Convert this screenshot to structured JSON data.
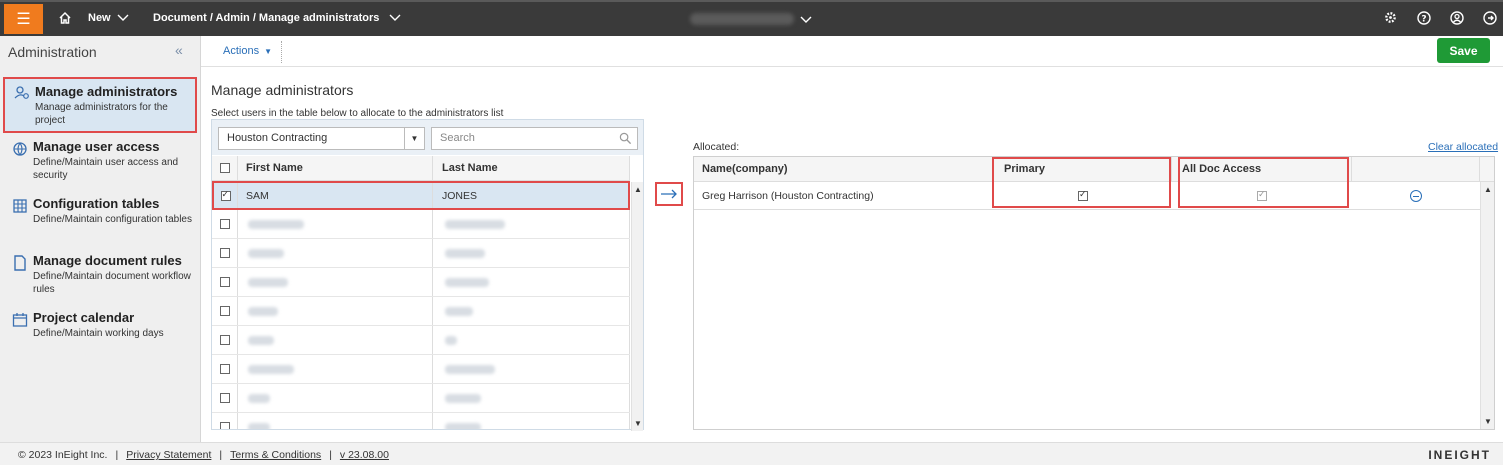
{
  "topbar": {
    "new_label": "New",
    "breadcrumb": "Document / Admin / Manage administrators"
  },
  "sidebar": {
    "title": "Administration",
    "items": [
      {
        "label": "Manage administrators",
        "desc": "Manage administrators for the project",
        "icon": "user-gear-icon"
      },
      {
        "label": "Manage user access",
        "desc": "Define/Maintain user access and security",
        "icon": "globe-icon"
      },
      {
        "label": "Configuration tables",
        "desc": "Define/Maintain configuration tables",
        "icon": "table-icon"
      },
      {
        "label": "Manage document rules",
        "desc": "Define/Maintain document workflow rules",
        "icon": "document-icon"
      },
      {
        "label": "Project calendar",
        "desc": "Define/Maintain working days",
        "icon": "calendar-icon"
      }
    ]
  },
  "toolbar": {
    "actions_label": "Actions",
    "save_label": "Save"
  },
  "main": {
    "title": "Manage administrators",
    "instruction": "Select users in the table below to allocate to the administrators list",
    "company_select": "Houston Contracting",
    "search_placeholder": "Search",
    "columns": [
      "First Name",
      "Last Name"
    ],
    "selected_row": {
      "first": "SAM",
      "last": "JONES"
    }
  },
  "allocated": {
    "label": "Allocated:",
    "clear_label": "Clear allocated",
    "columns": [
      "Name(company)",
      "Primary",
      "All Doc Access"
    ],
    "rows": [
      {
        "name": "Greg Harrison (Houston Contracting)",
        "primary": true,
        "all_doc_access": true
      }
    ]
  },
  "footer": {
    "copyright": "© 2023 InEight Inc.",
    "privacy": "Privacy Statement",
    "terms": "Terms & Conditions",
    "version": "v 23.08.00",
    "brand": "INEIGHT"
  },
  "colors": {
    "accent_orange": "#f07b1e",
    "link_blue": "#2a6fb8",
    "save_green": "#1f9a36",
    "highlight_red": "#e04a4a"
  }
}
